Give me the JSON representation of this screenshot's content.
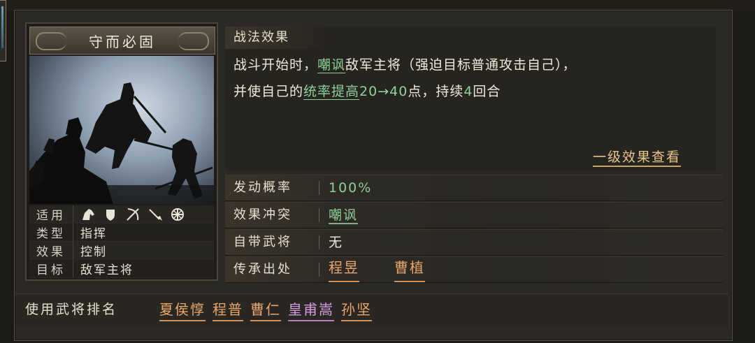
{
  "card": {
    "title": "守而必固",
    "info": [
      {
        "label": "适用",
        "icons": [
          "cavalry-icon",
          "shield-icon",
          "bow-icon",
          "spear-icon",
          "siege-icon"
        ]
      },
      {
        "label": "类型",
        "value": "指挥"
      },
      {
        "label": "效果",
        "value": "控制"
      },
      {
        "label": "目标",
        "value": "敌军主将"
      }
    ]
  },
  "effect": {
    "title": "战法效果",
    "line1_a": "战斗开始时，",
    "line1_link": "嘲讽",
    "line1_b": "敌军主将（强迫目标普通攻击自己），",
    "line2_a": "并使自己的",
    "line2_link": "统率提高",
    "line2_num": "20→40",
    "line2_b": "点，持续",
    "line2_num2": "4",
    "line2_c": "回合",
    "level_link": "一级效果查看"
  },
  "attributes": [
    {
      "label": "发动概率",
      "value": "100%"
    },
    {
      "label": "效果冲突",
      "value": "嘲讽"
    },
    {
      "label": "自带武将",
      "value": "无"
    },
    {
      "label": "传承出处",
      "values": [
        "程昱",
        "曹植"
      ]
    }
  ],
  "usage": {
    "label": "使用武将排名",
    "generals": [
      "夏侯惇",
      "程普",
      "曹仁",
      "皇甫嵩",
      "孙坚"
    ]
  },
  "colors": {
    "green_highlight": "#8fcf9a",
    "orange_general": "#e9a66a",
    "purple_general": "#d49ae0",
    "gold_link": "#e9c58a"
  }
}
